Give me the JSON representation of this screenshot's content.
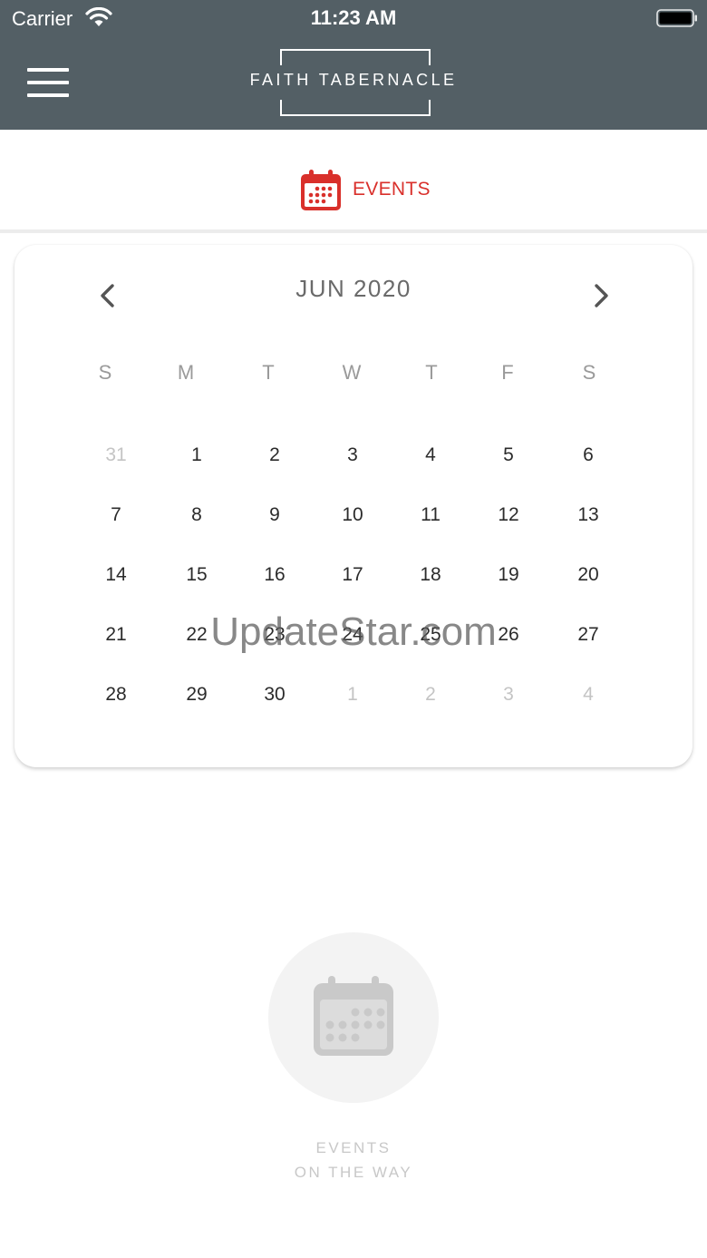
{
  "status_bar": {
    "carrier": "Carrier",
    "time": "11:23 AM"
  },
  "header": {
    "logo_text": "FAITH TABERNACLE",
    "menu_icon": "hamburger-menu-icon"
  },
  "tabs": {
    "events_label": "EVENTS",
    "events_icon": "calendar-icon",
    "accent_color": "#d9302b"
  },
  "calendar": {
    "month_label": "JUN 2020",
    "weekdays": [
      "S",
      "M",
      "T",
      "W",
      "T",
      "F",
      "S"
    ],
    "weeks": [
      [
        {
          "d": "31",
          "muted": true
        },
        {
          "d": "1"
        },
        {
          "d": "2"
        },
        {
          "d": "3"
        },
        {
          "d": "4"
        },
        {
          "d": "5"
        },
        {
          "d": "6"
        }
      ],
      [
        {
          "d": "7"
        },
        {
          "d": "8"
        },
        {
          "d": "9"
        },
        {
          "d": "10"
        },
        {
          "d": "11"
        },
        {
          "d": "12"
        },
        {
          "d": "13"
        }
      ],
      [
        {
          "d": "14"
        },
        {
          "d": "15"
        },
        {
          "d": "16"
        },
        {
          "d": "17"
        },
        {
          "d": "18"
        },
        {
          "d": "19"
        },
        {
          "d": "20"
        }
      ],
      [
        {
          "d": "21"
        },
        {
          "d": "22"
        },
        {
          "d": "23"
        },
        {
          "d": "24"
        },
        {
          "d": "25"
        },
        {
          "d": "26"
        },
        {
          "d": "27"
        }
      ],
      [
        {
          "d": "28"
        },
        {
          "d": "29"
        },
        {
          "d": "30"
        },
        {
          "d": "1",
          "muted": true
        },
        {
          "d": "2",
          "muted": true
        },
        {
          "d": "3",
          "muted": true
        },
        {
          "d": "4",
          "muted": true
        }
      ]
    ]
  },
  "watermark": "UpdateStar.com",
  "empty_state": {
    "line1": "EVENTS",
    "line2": "ON THE WAY",
    "icon": "calendar-icon"
  },
  "colors": {
    "header_bg": "#535f65",
    "accent": "#d9302b"
  }
}
